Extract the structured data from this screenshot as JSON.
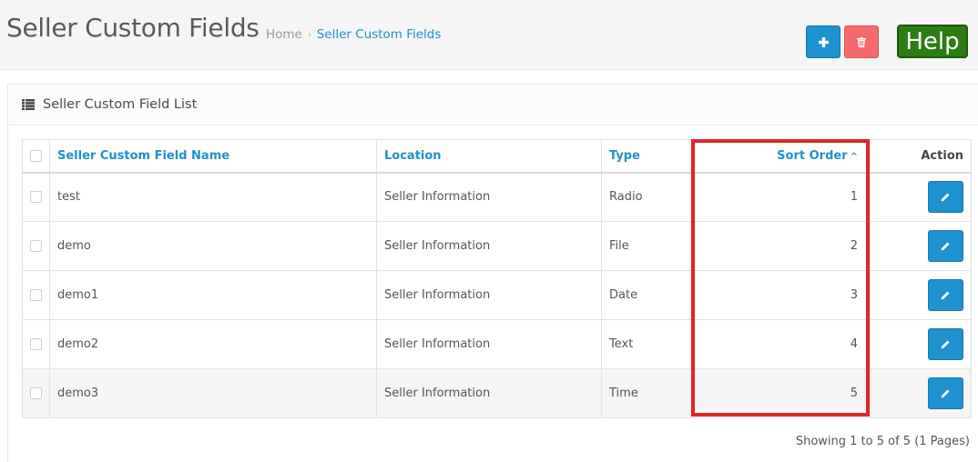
{
  "header": {
    "title": "Seller Custom Fields",
    "breadcrumb": {
      "home": "Home",
      "separator": "›",
      "current": "Seller Custom Fields"
    },
    "help_label": "Help",
    "colors": {
      "primary": "#1e91cf",
      "danger": "#f56b6b",
      "help": "#2b7d14",
      "highlight": "#e3242b"
    }
  },
  "panel": {
    "title": "Seller Custom Field List",
    "icon": "list-icon"
  },
  "table": {
    "columns": {
      "name": "Seller Custom Field Name",
      "location": "Location",
      "type": "Type",
      "sort_order": "Sort Order",
      "sort_caret": "^",
      "action": "Action"
    },
    "rows": [
      {
        "name": "test",
        "location": "Seller Information",
        "type": "Radio",
        "sort_order": "1"
      },
      {
        "name": "demo",
        "location": "Seller Information",
        "type": "File",
        "sort_order": "2"
      },
      {
        "name": "demo1",
        "location": "Seller Information",
        "type": "Date",
        "sort_order": "3"
      },
      {
        "name": "demo2",
        "location": "Seller Information",
        "type": "Text",
        "sort_order": "4"
      },
      {
        "name": "demo3",
        "location": "Seller Information",
        "type": "Time",
        "sort_order": "5"
      }
    ]
  },
  "pagination": {
    "info": "Showing 1 to 5 of 5 (1 Pages)"
  }
}
